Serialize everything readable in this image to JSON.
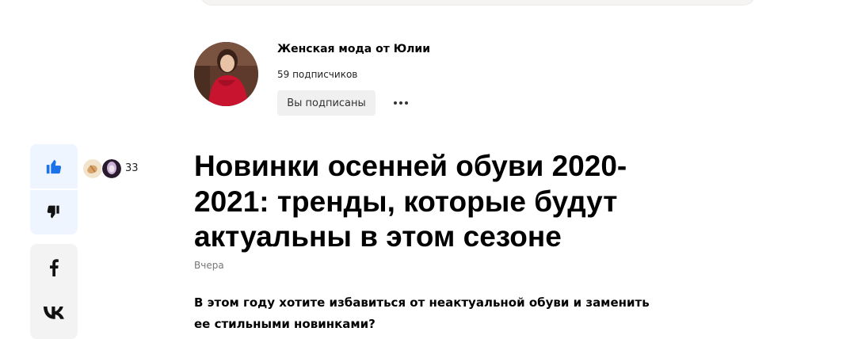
{
  "header": {
    "top_icon": "menu-icon"
  },
  "channel": {
    "name": "Женская мода от Юлии",
    "subscribers": "59 подписчиков",
    "subscribe_button_label": "Вы подписаны",
    "more_icon": "more-dots-icon"
  },
  "reactions": {
    "like_icon": "thumb-up-icon",
    "dislike_icon": "thumb-down-icon",
    "like_count": "33",
    "accent_color": "#1a73e8"
  },
  "share": {
    "facebook_icon": "facebook-icon",
    "vk_icon": "vk-icon"
  },
  "article": {
    "title": "Новинки осенней обуви 2020-2021: тренды, которые будут актуальны в этом сезоне",
    "date": "Вчера",
    "lead": "В этом году хотите избавиться от неактуальной обуви и заменить ее стильными новинками?"
  }
}
